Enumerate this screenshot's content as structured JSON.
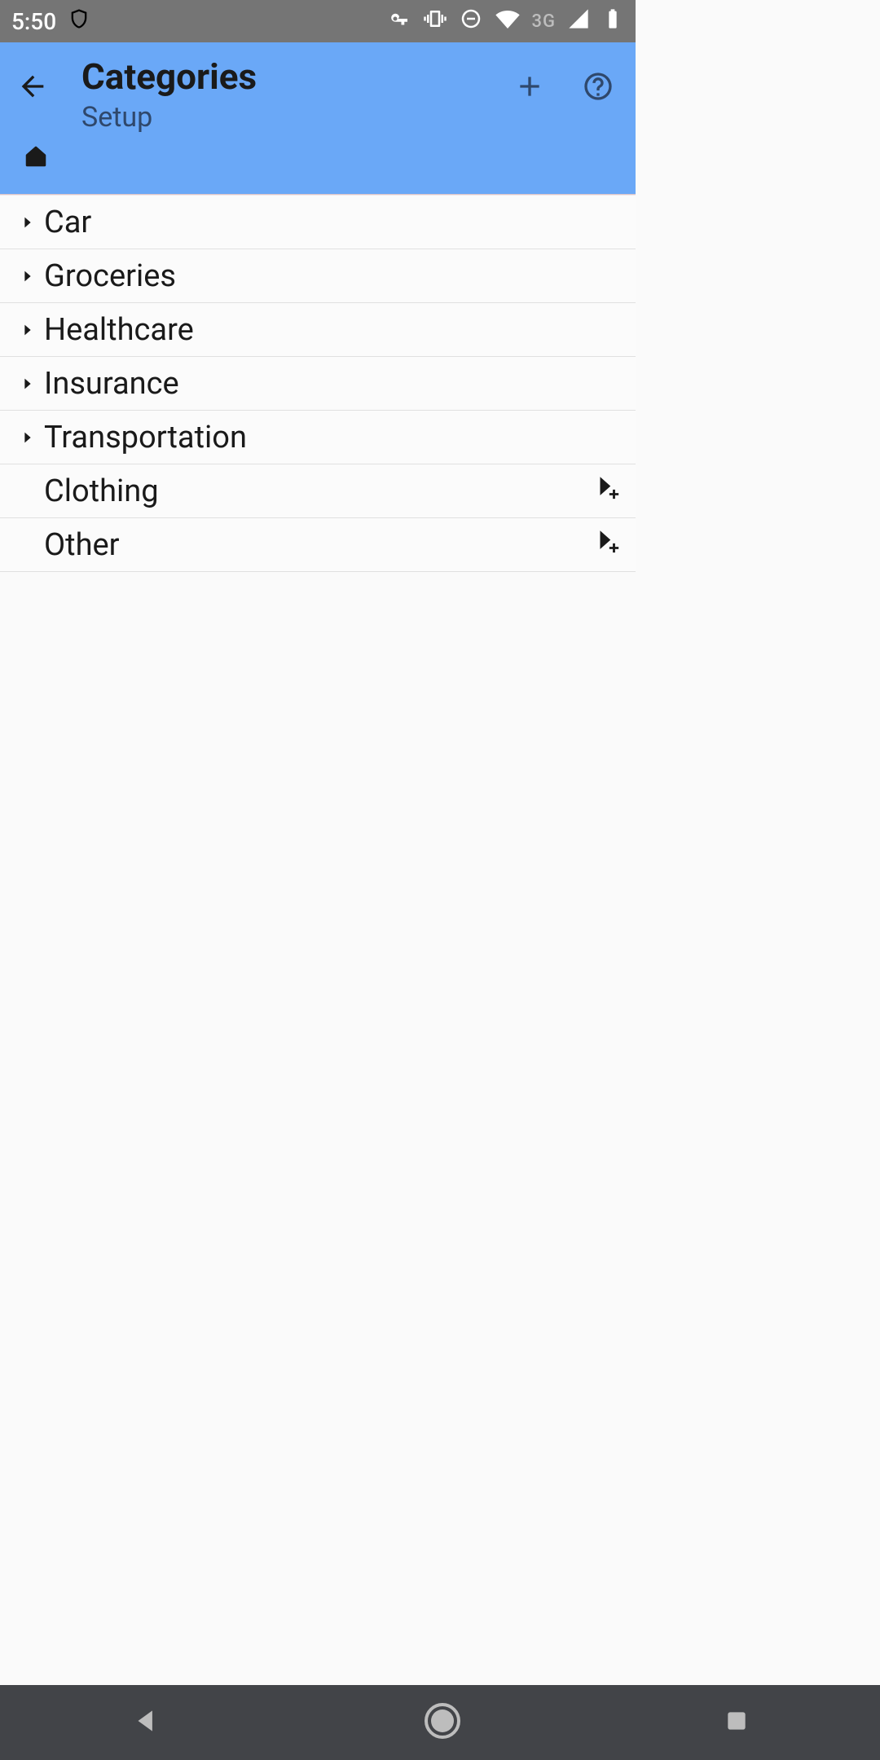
{
  "status": {
    "time": "5:50",
    "network_label": "3G"
  },
  "appbar": {
    "title": "Categories",
    "subtitle": "Setup"
  },
  "categories": [
    {
      "label": "Car",
      "expandable": true,
      "add_sub": false
    },
    {
      "label": "Groceries",
      "expandable": true,
      "add_sub": false
    },
    {
      "label": "Healthcare",
      "expandable": true,
      "add_sub": false
    },
    {
      "label": "Insurance",
      "expandable": true,
      "add_sub": false
    },
    {
      "label": "Transportation",
      "expandable": true,
      "add_sub": false
    },
    {
      "label": "Clothing",
      "expandable": false,
      "add_sub": true
    },
    {
      "label": "Other",
      "expandable": false,
      "add_sub": true
    }
  ]
}
